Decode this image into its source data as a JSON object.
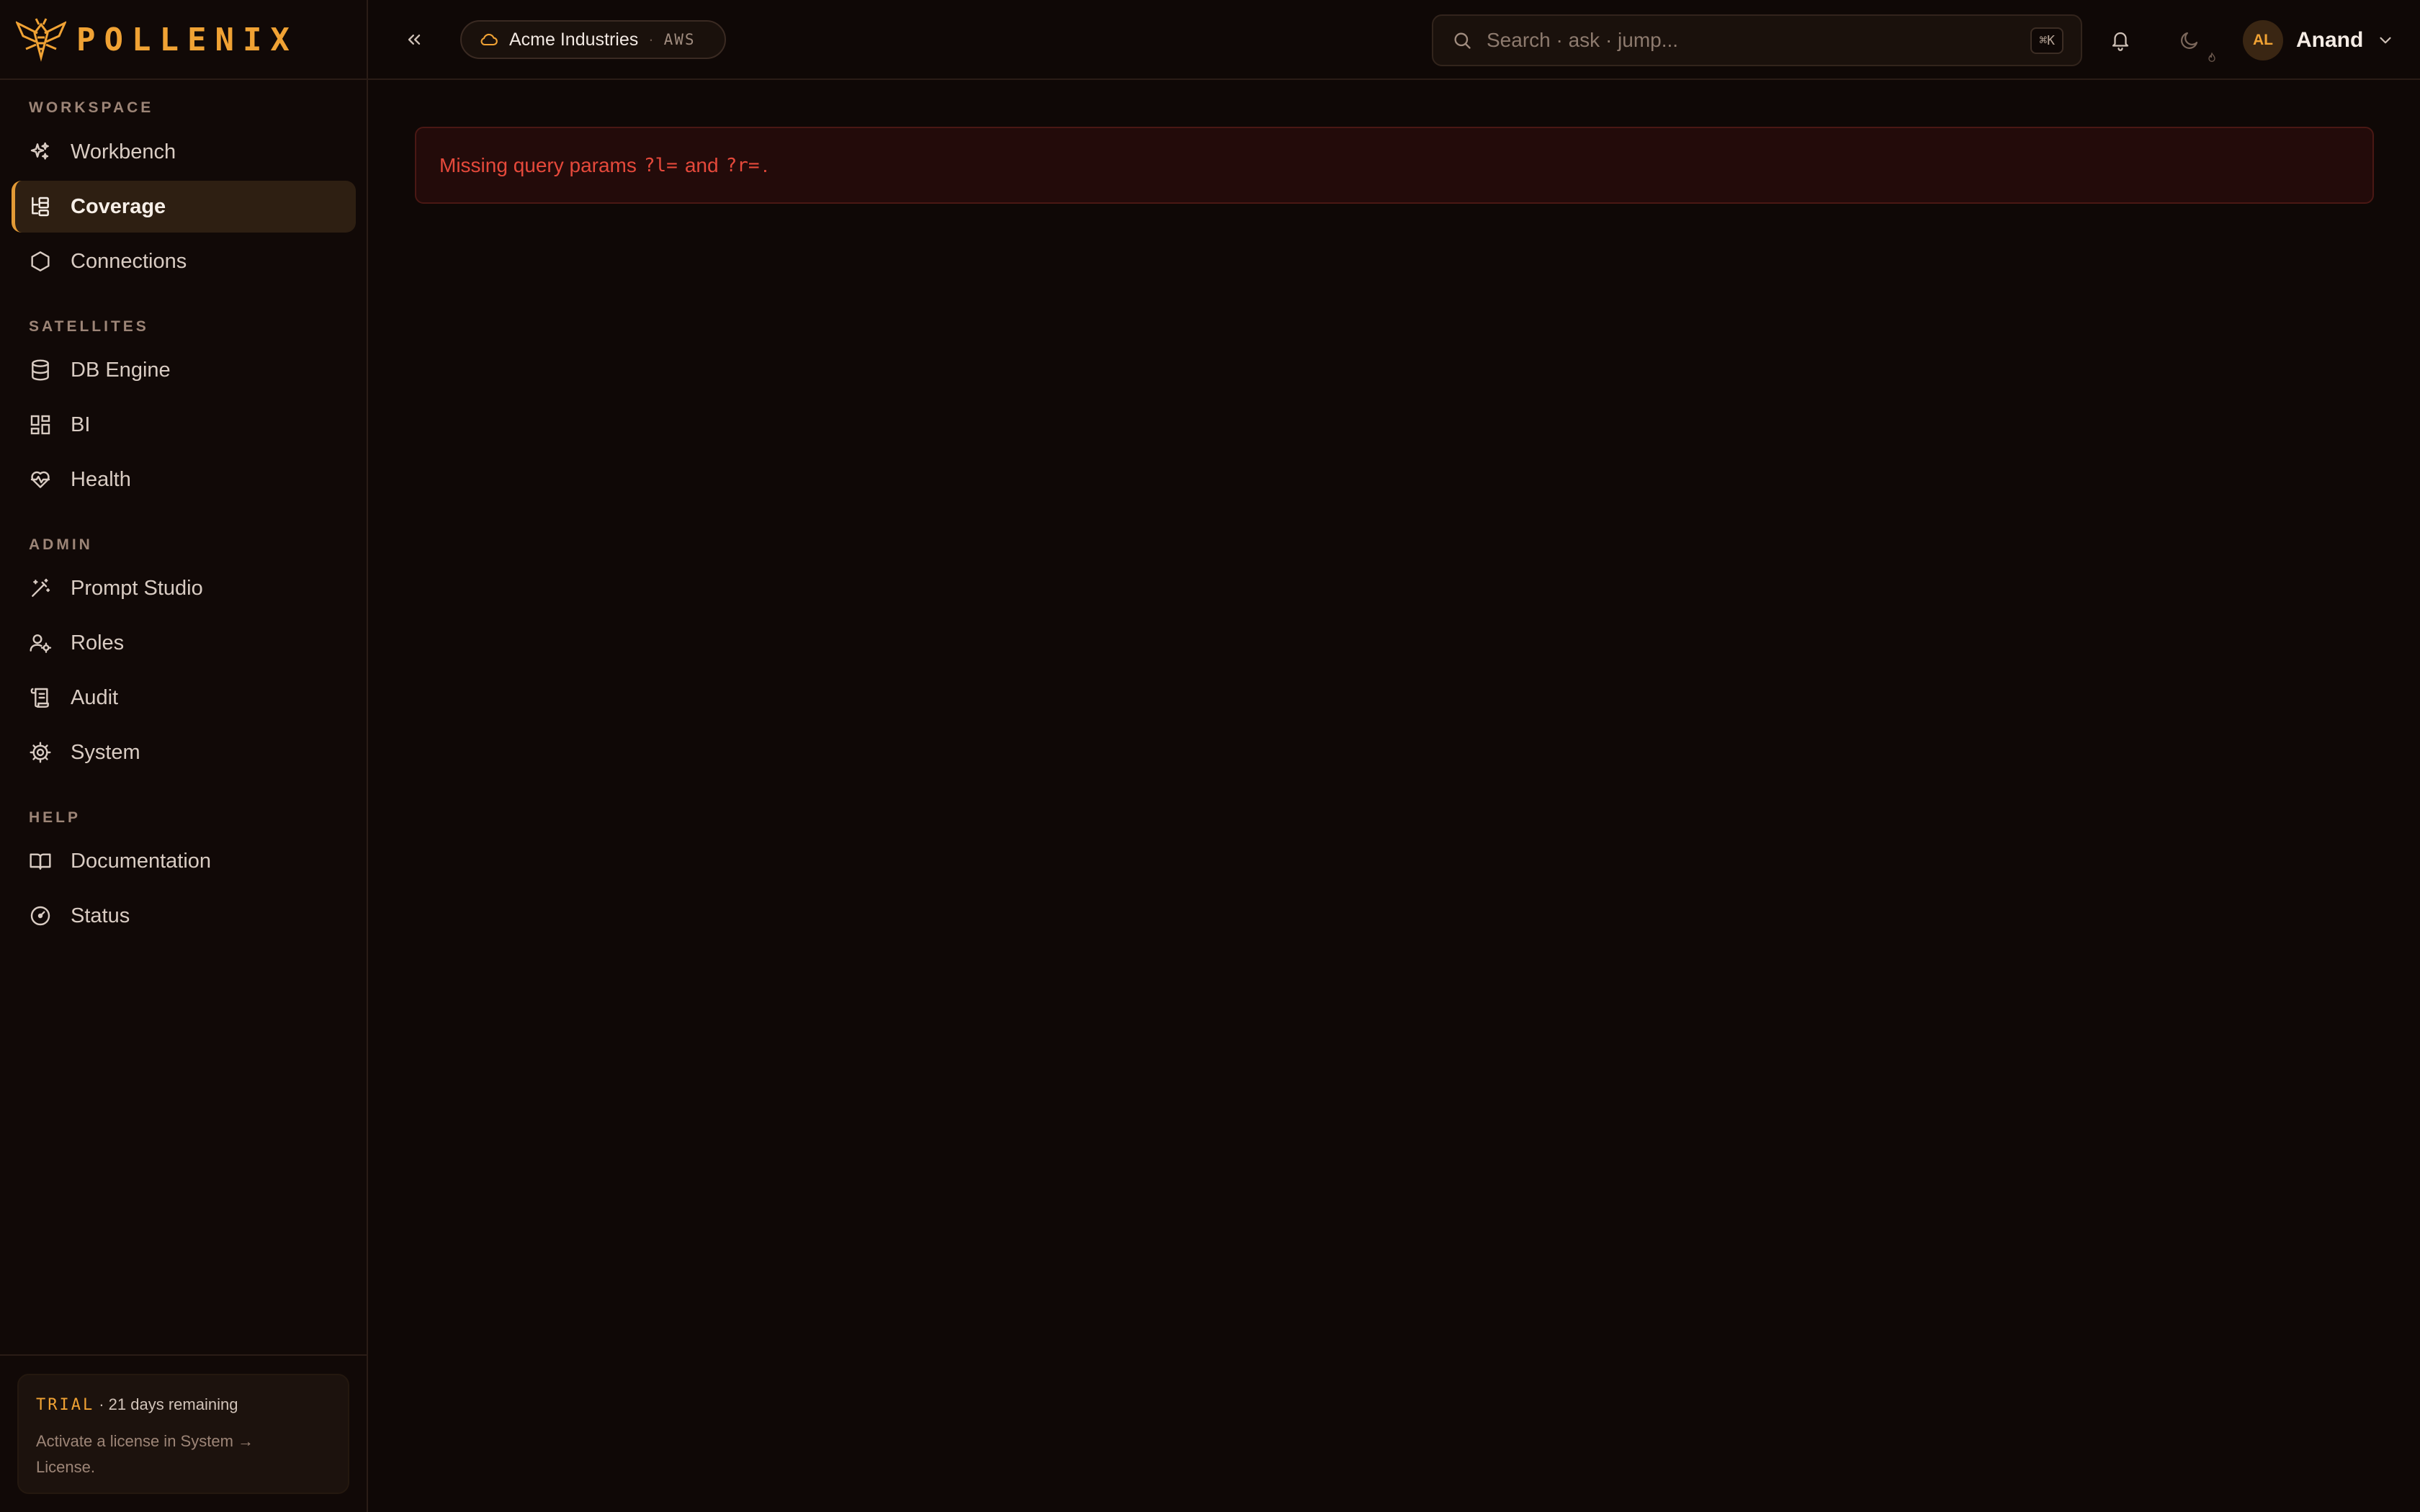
{
  "brand": {
    "name": "POLLENIX",
    "accent": "#f0a234"
  },
  "topbar": {
    "tenant_name": "Acme Industries",
    "tenant_sep": "·",
    "tenant_cloud": "AWS",
    "search_placeholder": "Search · ask · jump...",
    "search_shortcut": "⌘K",
    "user_initials": "AL",
    "user_name": "Anand"
  },
  "sidebar": {
    "sections": {
      "workspace": "WORKSPACE",
      "satellites": "SATELLITES",
      "admin": "ADMIN",
      "help": "HELP"
    },
    "items": [
      {
        "label": "Workbench",
        "icon": "sparkles-icon"
      },
      {
        "label": "Coverage",
        "icon": "tree-icon",
        "active": true
      },
      {
        "label": "Connections",
        "icon": "hexagon-icon"
      },
      {
        "label": "DB Engine",
        "icon": "database-icon"
      },
      {
        "label": "BI",
        "icon": "grid-icon"
      },
      {
        "label": "Health",
        "icon": "heart-pulse-icon"
      },
      {
        "label": "Prompt Studio",
        "icon": "wand-icon"
      },
      {
        "label": "Roles",
        "icon": "user-cog-icon"
      },
      {
        "label": "Audit",
        "icon": "scroll-icon"
      },
      {
        "label": "System",
        "icon": "gear-icon"
      },
      {
        "label": "Documentation",
        "icon": "book-icon"
      },
      {
        "label": "Status",
        "icon": "gauge-icon"
      }
    ],
    "trial": {
      "tag": "TRIAL",
      "remaining": "· 21 days remaining",
      "message": "Activate a license in System → License."
    }
  },
  "main": {
    "error": {
      "prefix": "Missing query params",
      "param_l": "?l=",
      "conjunction": "and",
      "param_r": "?r=",
      "suffix": "."
    }
  }
}
